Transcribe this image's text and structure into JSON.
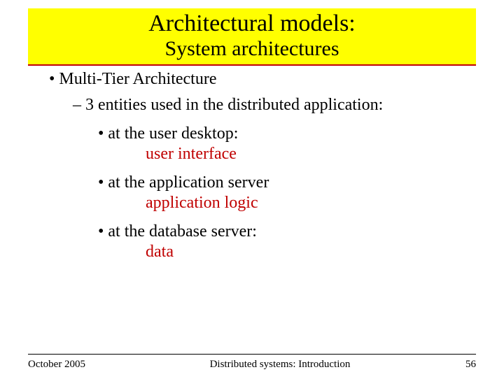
{
  "title": {
    "main": "Architectural models:",
    "sub": "System architectures"
  },
  "bullets": {
    "lvl1": "Multi-Tier Architecture",
    "lvl2": "3 entities used in the distributed application:",
    "items": [
      {
        "where": "at the  user desktop:",
        "what": "user interface"
      },
      {
        "where": "at the application server",
        "what": "application logic"
      },
      {
        "where": "at the database server:",
        "what": "data"
      }
    ]
  },
  "footer": {
    "date": "October 2005",
    "course": "Distributed systems: Introduction",
    "page": "56"
  }
}
